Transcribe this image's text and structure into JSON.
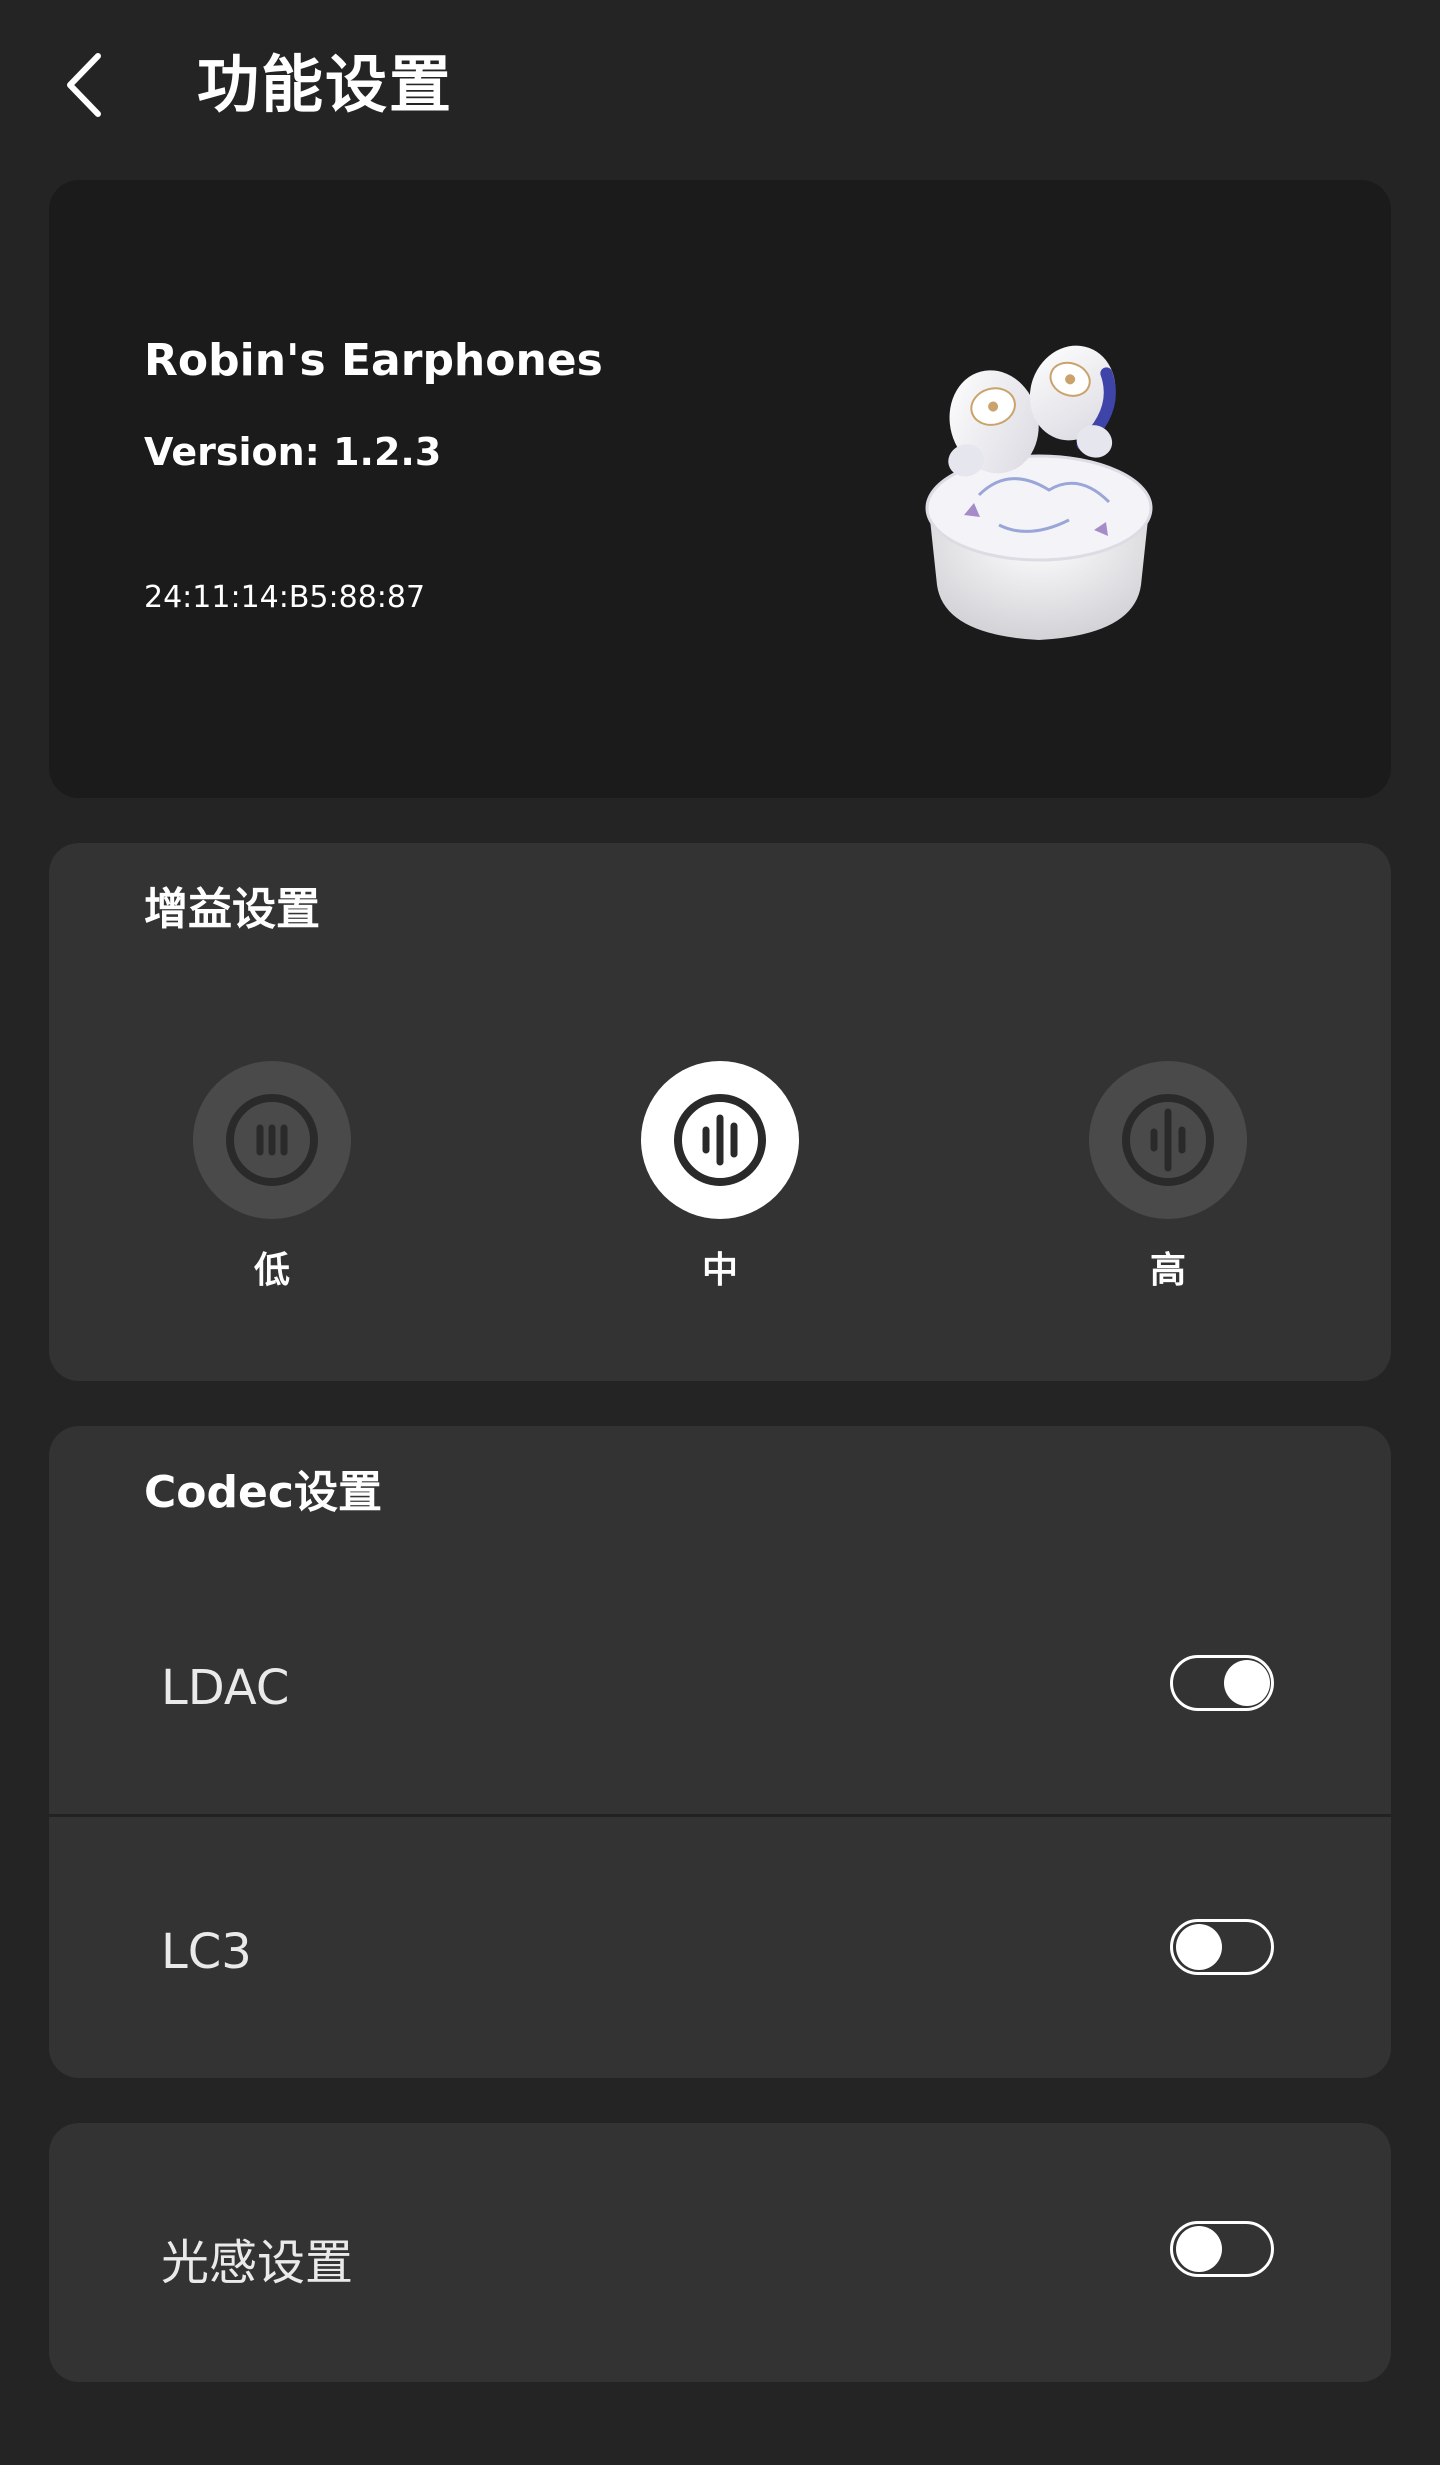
{
  "header": {
    "title": "功能设置",
    "back_icon": "chevron-left-icon"
  },
  "device": {
    "name": "Robin's Earphones",
    "version": "Version: 1.2.3",
    "mac": "24:11:14:B5:88:87",
    "image": "earphones-with-case-image"
  },
  "gain": {
    "title": "增益设置",
    "options": [
      {
        "label": "低",
        "icon": "low-gain-waveform-icon",
        "selected": false
      },
      {
        "label": "中",
        "icon": "medium-gain-waveform-icon",
        "selected": true
      },
      {
        "label": "高",
        "icon": "high-gain-waveform-icon",
        "selected": false
      }
    ]
  },
  "codec": {
    "title": "Codec设置",
    "items": [
      {
        "label": "LDAC",
        "enabled": true
      },
      {
        "label": "LC3",
        "enabled": false
      }
    ]
  },
  "light_sensor": {
    "label": "光感设置",
    "enabled": false
  },
  "colors": {
    "background": "#242424",
    "card": "#333333",
    "device_card": "#1b1b1b",
    "accent": "#ffffff"
  }
}
